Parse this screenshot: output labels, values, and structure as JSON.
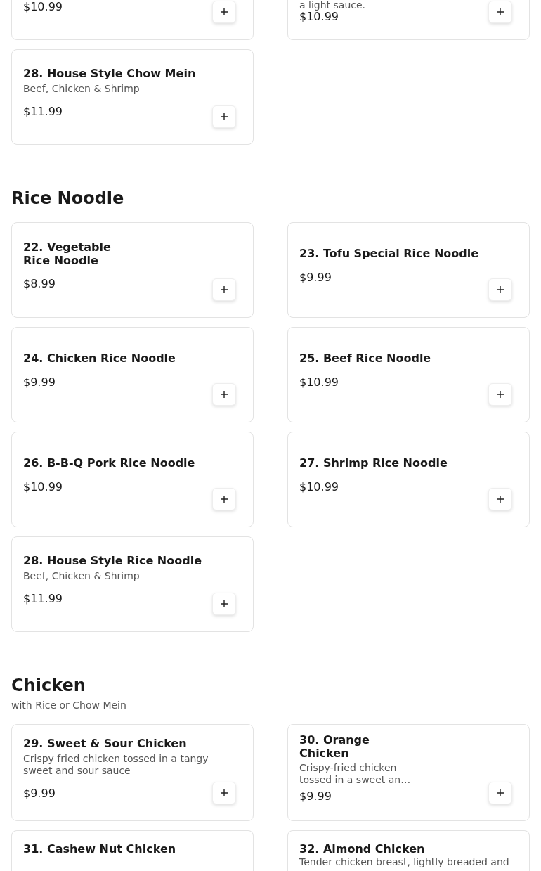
{
  "sections": [
    {
      "items": [
        {
          "price": "$10.99"
        },
        {
          "description": "a light sauce.",
          "price": "$10.99"
        },
        {
          "title": "28. House Style Chow Mein",
          "description": "Beef, Chicken & Shrimp",
          "price": "$11.99",
          "compact": false
        }
      ]
    },
    {
      "title": "Rice Noodle",
      "items": [
        {
          "title": "22. Vegetable Rice Noodle",
          "price": "$8.99",
          "compact": true
        },
        {
          "title": "23. Tofu Special Rice Noodle",
          "price": "$9.99",
          "compact": false
        },
        {
          "title": "24. Chicken Rice Noodle",
          "price": "$9.99",
          "compact": false
        },
        {
          "title": "25. Beef Rice Noodle",
          "price": "$10.99",
          "compact": false
        },
        {
          "title": "26. B-B-Q Pork Rice Noodle",
          "price": "$10.99",
          "compact": false
        },
        {
          "title": "27. Shrimp Rice Noodle",
          "price": "$10.99",
          "compact": false
        },
        {
          "title": "28. House Style Rice Noodle",
          "description": "Beef, Chicken & Shrimp",
          "price": "$11.99",
          "compact": false
        }
      ]
    },
    {
      "title": "Chicken",
      "subtitle": "with Rice or Chow Mein",
      "items": [
        {
          "title": "29. Sweet & Sour Chicken",
          "description": "Crispy fried chicken tossed in a tangy sweet and sour sauce",
          "price": "$9.99",
          "compact": false
        },
        {
          "title": "30. Orange Chicken",
          "description": "Crispy-fried chicken tossed in a sweet an…",
          "price": "$9.99",
          "compact": true
        },
        {
          "title": "31. Cashew Nut Chicken",
          "compact": false
        },
        {
          "title": "32. Almond Chicken",
          "description": "Tender chicken breast, lightly breaded and",
          "compact": false
        }
      ]
    }
  ]
}
